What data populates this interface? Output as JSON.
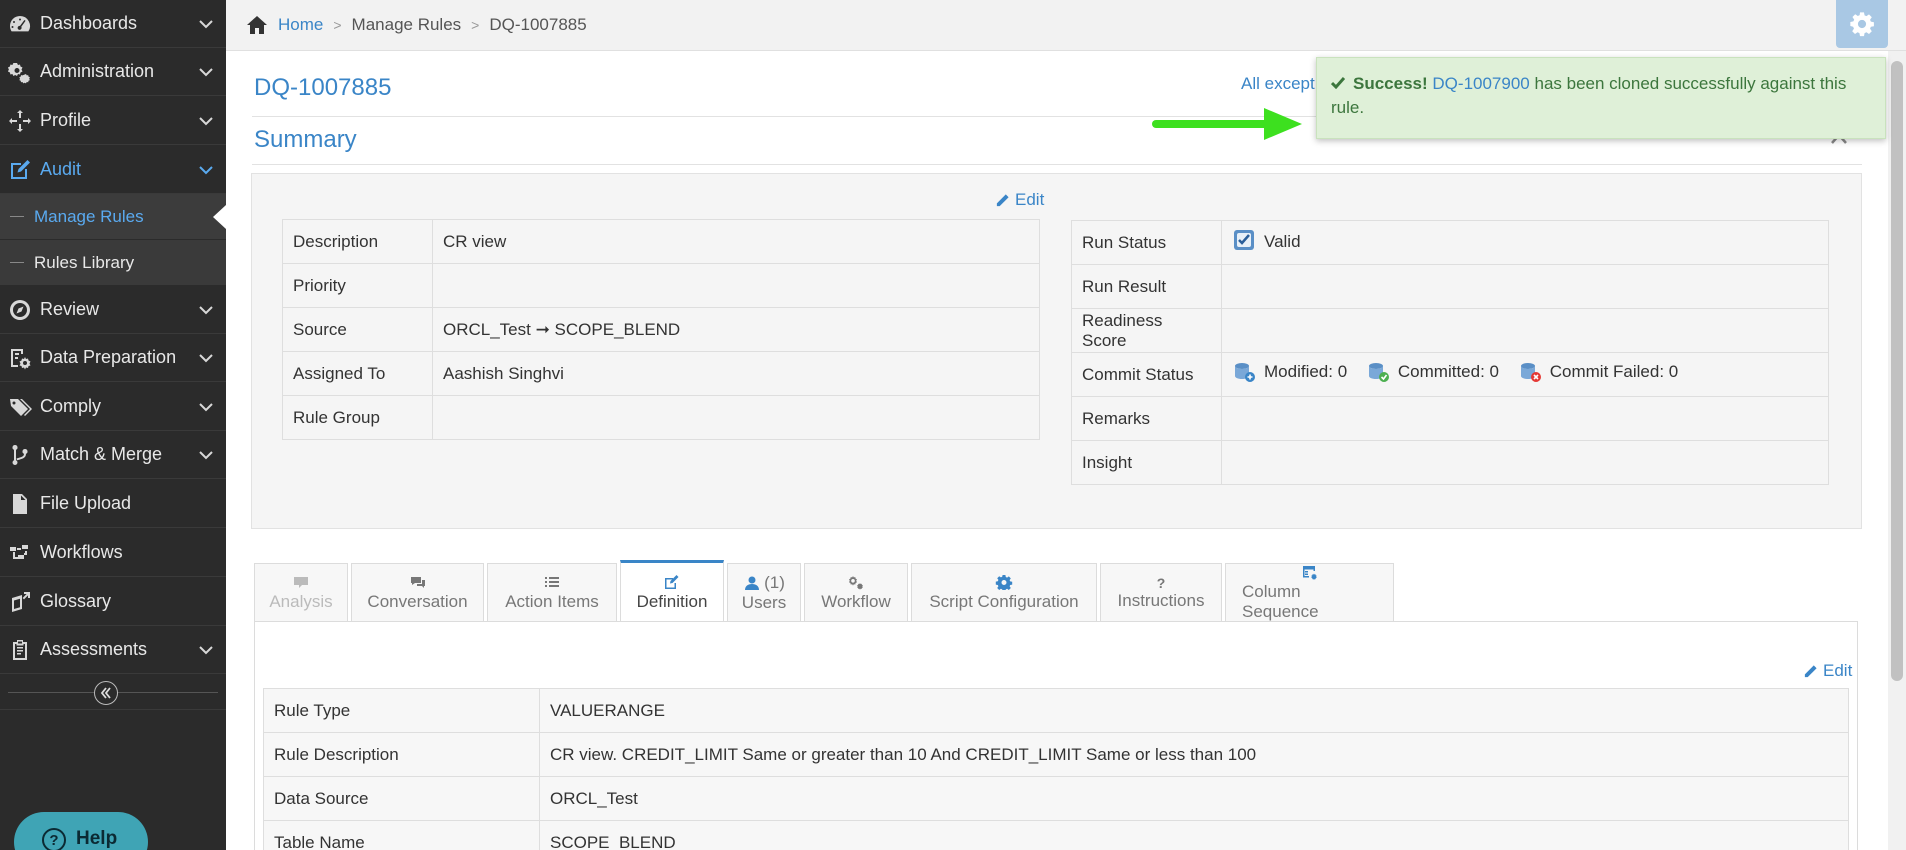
{
  "sidebar": {
    "items": [
      {
        "label": "Dashboards",
        "icon": "dashboard-icon"
      },
      {
        "label": "Administration",
        "icon": "gears-icon"
      },
      {
        "label": "Profile",
        "icon": "move-icon"
      },
      {
        "label": "Audit",
        "icon": "edit-icon"
      },
      {
        "label": "Review",
        "icon": "compass-icon"
      },
      {
        "label": "Data Preparation",
        "icon": "data-prep-icon"
      },
      {
        "label": "Comply",
        "icon": "tags-icon"
      },
      {
        "label": "Match & Merge",
        "icon": "merge-icon"
      },
      {
        "label": "File Upload",
        "icon": "file-icon"
      },
      {
        "label": "Workflows",
        "icon": "workflow-icon"
      },
      {
        "label": "Glossary",
        "icon": "glossary-icon"
      },
      {
        "label": "Assessments",
        "icon": "clipboard-icon"
      }
    ],
    "audit_sub": [
      {
        "label": "Manage Rules"
      },
      {
        "label": "Rules Library"
      }
    ],
    "help_label": "Help"
  },
  "breadcrumb": {
    "home": "Home",
    "manage_rules": "Manage Rules",
    "current": "DQ-1007885"
  },
  "header": {
    "rule_id": "DQ-1007885",
    "all_exceptions": "All except",
    "summary_title": "Summary"
  },
  "toast": {
    "prefix": "Success!",
    "rule_link": "DQ-1007900",
    "message": "has been cloned successfully against this rule."
  },
  "summary": {
    "edit_label": "Edit",
    "left": [
      {
        "key": "Description",
        "value": "CR view"
      },
      {
        "key": "Priority",
        "value": ""
      },
      {
        "key": "Source",
        "value": "ORCL_Test ➞ SCOPE_BLEND"
      },
      {
        "key": "Assigned To",
        "value": "Aashish Singhvi"
      },
      {
        "key": "Rule Group",
        "value": ""
      }
    ],
    "right": {
      "run_status_key": "Run Status",
      "run_status_value": "Valid",
      "run_result_key": "Run Result",
      "run_result_value": "",
      "readiness_key": "Readiness Score",
      "readiness_value": "",
      "commit_key": "Commit Status",
      "modified": "Modified: 0",
      "committed": "Committed: 0",
      "commit_failed": "Commit Failed: 0",
      "remarks_key": "Remarks",
      "remarks_value": "",
      "insight_key": "Insight",
      "insight_value": ""
    }
  },
  "tabs": [
    {
      "label": "Analysis",
      "state": "disabled"
    },
    {
      "label": "Conversation",
      "state": "normal"
    },
    {
      "label": "Action Items",
      "state": "normal"
    },
    {
      "label": "Definition",
      "state": "active"
    },
    {
      "label": "Users",
      "count": "(1)",
      "state": "normal"
    },
    {
      "label": "Workflow",
      "state": "normal"
    },
    {
      "label": "Script Configuration",
      "state": "normal"
    },
    {
      "label": "Instructions",
      "state": "normal"
    },
    {
      "label": "Column Sequence",
      "state": "normal"
    }
  ],
  "definition": {
    "edit_label": "Edit",
    "rows": [
      {
        "key": "Rule Type",
        "value": "VALUERANGE"
      },
      {
        "key": "Rule Description",
        "value": "CR view. CREDIT_LIMIT Same or greater than 10 And CREDIT_LIMIT Same or less than 100"
      },
      {
        "key": "Data Source",
        "value": "ORCL_Test"
      },
      {
        "key": "Table Name",
        "value": "SCOPE_BLEND"
      }
    ]
  },
  "colors": {
    "accent": "#3a85c7",
    "sidebar_bg": "#2b2b2b",
    "success_bg": "#dff0d8",
    "success_text": "#3c763d",
    "arrow": "#3de01f"
  }
}
